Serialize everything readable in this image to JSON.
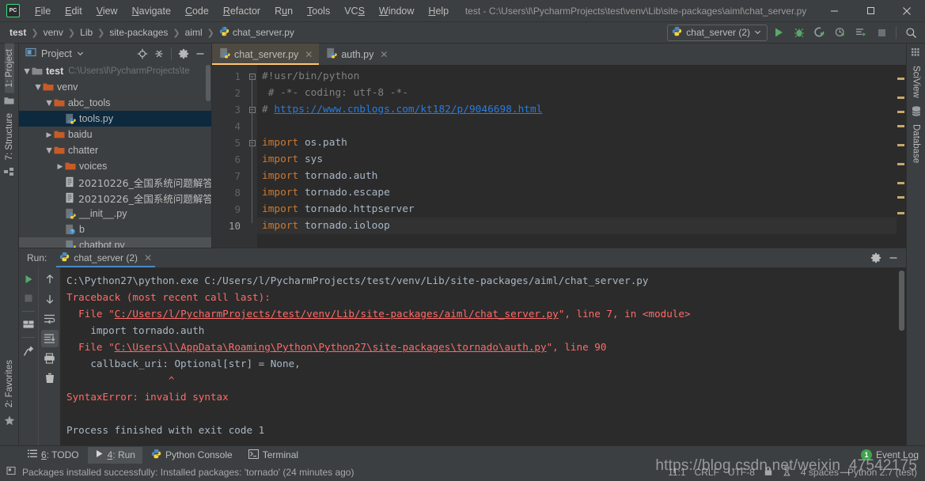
{
  "window": {
    "title": "test - C:\\Users\\l\\PycharmProjects\\test\\venv\\Lib\\site-packages\\aiml\\chat_server.py",
    "logo": "PC",
    "minimize": "—",
    "maximize": "☐",
    "close": "✕"
  },
  "menu": [
    {
      "label": "File"
    },
    {
      "label": "Edit"
    },
    {
      "label": "View"
    },
    {
      "label": "Navigate"
    },
    {
      "label": "Code"
    },
    {
      "label": "Refactor"
    },
    {
      "label": "Run"
    },
    {
      "label": "Tools"
    },
    {
      "label": "VCS"
    },
    {
      "label": "Window"
    },
    {
      "label": "Help"
    }
  ],
  "breadcrumbs": [
    {
      "label": "test"
    },
    {
      "label": "venv"
    },
    {
      "label": "Lib"
    },
    {
      "label": "site-packages"
    },
    {
      "label": "aiml"
    },
    {
      "label": "chat_server.py"
    }
  ],
  "toolbar": {
    "run_config": "chat_server (2)",
    "run_icon": "run-icon",
    "debug_icon": "debug-icon",
    "coverage_icon": "run-with-coverage-icon",
    "profile_icon": "profile-icon",
    "attach_icon": "run-anything-icon",
    "stop_icon": "stop-icon",
    "search_icon": "search-everywhere-icon"
  },
  "left_strip": [
    {
      "label": "1: Project",
      "active": true
    },
    {
      "label": "7: Structure",
      "active": false
    },
    {
      "label": "2: Favorites",
      "active": false
    }
  ],
  "right_strip": [
    {
      "label": "SciView"
    },
    {
      "label": "Database"
    }
  ],
  "project_panel": {
    "title": "Project",
    "locate_icon": "locate-icon",
    "collapse_icon": "collapse-all-icon",
    "settings_icon": "gear-icon",
    "hide_icon": "hide-icon",
    "tree": [
      {
        "indent": 0,
        "arrow": "▼",
        "icon": "folder",
        "label": "test",
        "bold": true,
        "path": "C:\\Users\\l\\PycharmProjects\\te",
        "selected": false
      },
      {
        "indent": 1,
        "arrow": "▼",
        "icon": "folder",
        "label": "venv",
        "bold": false,
        "path": "",
        "selected": false
      },
      {
        "indent": 2,
        "arrow": "▼",
        "icon": "folder",
        "label": "abc_tools",
        "bold": false,
        "path": "",
        "selected": false
      },
      {
        "indent": 3,
        "arrow": "",
        "icon": "python",
        "label": "tools.py",
        "bold": false,
        "path": "",
        "selected": true
      },
      {
        "indent": 2,
        "arrow": "▶",
        "icon": "folder",
        "label": "baidu",
        "bold": false,
        "path": "",
        "selected": false
      },
      {
        "indent": 2,
        "arrow": "▼",
        "icon": "folder",
        "label": "chatter",
        "bold": false,
        "path": "",
        "selected": false
      },
      {
        "indent": 3,
        "arrow": "▶",
        "icon": "folder",
        "label": "voices",
        "bold": false,
        "path": "",
        "selected": false
      },
      {
        "indent": 3,
        "arrow": "",
        "icon": "doc",
        "label": "20210226_全国系统问题解答",
        "bold": false,
        "path": "",
        "selected": false
      },
      {
        "indent": 3,
        "arrow": "",
        "icon": "doc",
        "label": "20210226_全国系统问题解答",
        "bold": false,
        "path": "",
        "selected": false
      },
      {
        "indent": 3,
        "arrow": "",
        "icon": "python",
        "label": "__init__.py",
        "bold": false,
        "path": "",
        "selected": false
      },
      {
        "indent": 3,
        "arrow": "",
        "icon": "unknown",
        "label": "b",
        "bold": false,
        "path": "",
        "selected": false
      },
      {
        "indent": 3,
        "arrow": "",
        "icon": "python",
        "label": "chatbot.py",
        "bold": false,
        "path": "",
        "selected": false
      }
    ]
  },
  "editor": {
    "tabs": [
      {
        "label": "chat_server.py",
        "icon": "python-file-icon",
        "active": true,
        "close": "✕"
      },
      {
        "label": "auth.py",
        "icon": "python-file-icon",
        "active": false,
        "close": "✕"
      }
    ],
    "lines": [
      {
        "n": "1",
        "fold": "minus",
        "segments": [
          {
            "t": "#!usr/bin/python",
            "c": "cmt"
          }
        ]
      },
      {
        "n": "2",
        "fold": "",
        "segments": [
          {
            "t": " # -*- coding: utf-8 -*-",
            "c": "cmt"
          }
        ]
      },
      {
        "n": "3",
        "fold": "minus",
        "segments": [
          {
            "t": "# ",
            "c": "cmt"
          },
          {
            "t": "https://www.cnblogs.com/kt182/p/9046698.html",
            "c": "lnk"
          }
        ]
      },
      {
        "n": "4",
        "fold": "",
        "segments": [
          {
            "t": "",
            "c": "txt"
          }
        ]
      },
      {
        "n": "5",
        "fold": "minus",
        "segments": [
          {
            "t": "import",
            "c": "kw"
          },
          {
            "t": " os.path",
            "c": "txt"
          }
        ]
      },
      {
        "n": "6",
        "fold": "",
        "segments": [
          {
            "t": "import",
            "c": "kw"
          },
          {
            "t": " sys",
            "c": "txt"
          }
        ]
      },
      {
        "n": "7",
        "fold": "",
        "segments": [
          {
            "t": "import",
            "c": "kw"
          },
          {
            "t": " tornado.auth",
            "c": "txt"
          }
        ]
      },
      {
        "n": "8",
        "fold": "",
        "segments": [
          {
            "t": "import",
            "c": "kw"
          },
          {
            "t": " tornado.escape",
            "c": "txt"
          }
        ]
      },
      {
        "n": "9",
        "fold": "",
        "segments": [
          {
            "t": "import",
            "c": "kw"
          },
          {
            "t": " tornado.httpserver",
            "c": "txt"
          }
        ]
      },
      {
        "n": "10",
        "fold": "",
        "segments": [
          {
            "t": "import",
            "c": "kw"
          },
          {
            "t": " tornado.ioloop",
            "c": "txt"
          }
        ],
        "current": true
      }
    ]
  },
  "run_panel": {
    "label": "Run:",
    "tab": "chat_server (2)",
    "tab_close": "✕",
    "settings_icon": "gear-icon",
    "hide_icon": "hide-icon",
    "tools": [
      {
        "name": "rerun-icon"
      },
      {
        "name": "stop-icon"
      },
      {
        "name": "restore-layout-icon"
      },
      {
        "name": "pin-tab-icon"
      }
    ],
    "tools2": [
      {
        "name": "up-arrow-icon"
      },
      {
        "name": "down-arrow-icon"
      },
      {
        "name": "soft-wrap-icon"
      },
      {
        "name": "scroll-to-end-icon"
      },
      {
        "name": "print-icon"
      },
      {
        "name": "clear-all-icon"
      }
    ],
    "console": [
      {
        "segments": [
          {
            "t": "C:\\Python27\\python.exe C:/Users/l/PycharmProjects/test/venv/Lib/site-packages/aiml/chat_server.py",
            "c": "c-out"
          }
        ]
      },
      {
        "segments": [
          {
            "t": "Traceback (most recent call last):",
            "c": "c-err"
          }
        ]
      },
      {
        "segments": [
          {
            "t": "  File \"",
            "c": "c-err"
          },
          {
            "t": "C:/Users/l/PycharmProjects/test/venv/Lib/site-packages/aiml/chat_server.py",
            "c": "c-lnk"
          },
          {
            "t": "\", line 7, in <module>",
            "c": "c-err"
          }
        ]
      },
      {
        "segments": [
          {
            "t": "    import tornado.auth",
            "c": "c-out"
          }
        ]
      },
      {
        "segments": [
          {
            "t": "  File \"",
            "c": "c-err"
          },
          {
            "t": "C:\\Users\\l\\AppData\\Roaming\\Python\\Python27\\site-packages\\tornado\\auth.py",
            "c": "c-lnk"
          },
          {
            "t": "\", line 90",
            "c": "c-err"
          }
        ]
      },
      {
        "segments": [
          {
            "t": "    callback_uri: Optional[str] = None,",
            "c": "c-out"
          }
        ]
      },
      {
        "segments": [
          {
            "t": "                 ^",
            "c": "c-err"
          }
        ]
      },
      {
        "segments": [
          {
            "t": "SyntaxError: invalid syntax",
            "c": "c-err"
          }
        ]
      },
      {
        "segments": [
          {
            "t": "",
            "c": "c-out"
          }
        ]
      },
      {
        "segments": [
          {
            "t": "Process finished with exit code 1",
            "c": "c-out"
          }
        ]
      }
    ]
  },
  "bottom_bar": {
    "items": [
      {
        "label": "6: TODO",
        "icon": "todo-icon",
        "active": false
      },
      {
        "label": "4: Run",
        "icon": "run-icon",
        "active": true
      },
      {
        "label": "Python Console",
        "icon": "python-icon",
        "active": false
      },
      {
        "label": "Terminal",
        "icon": "terminal-icon",
        "active": false
      }
    ],
    "event_log": "Event Log",
    "event_count": "1"
  },
  "status_bar": {
    "message": "Packages installed successfully: Installed packages: 'tornado' (24 minutes ago)",
    "message_icon": "balloon-icon",
    "caret": "11:1",
    "line_separator": "CRLF",
    "encoding": "UTF-8",
    "lock_icon": "lock-icon",
    "inspection_icon": "inspection-icon",
    "indent": "4 spaces",
    "interpreter": "Python 2.7 (test)"
  },
  "watermark": "https://blog.csdn.net/weixin_47542175",
  "colors": {
    "accent_green": "#3fa34d",
    "tab_underline": "#ffc66d",
    "run_tab_underline": "#4a88c7",
    "selection": "#0d293e",
    "error_red": "#ff6b68",
    "link_blue": "#287bde",
    "keyword_orange": "#cc7832"
  }
}
